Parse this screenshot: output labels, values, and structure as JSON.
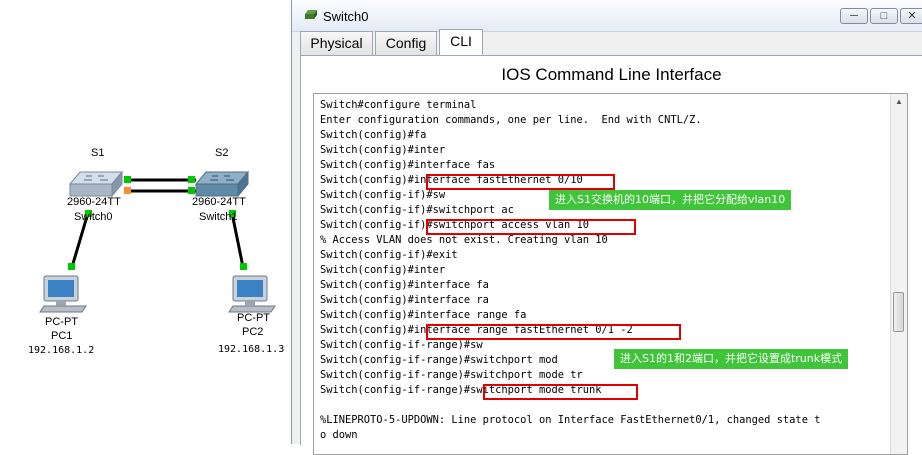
{
  "topology": {
    "switch1": {
      "name": "S1",
      "model": "2960-24TT",
      "hostname": "Switch0"
    },
    "switch2": {
      "name": "S2",
      "model": "2960-24TT",
      "hostname": "Switch1"
    },
    "pc1": {
      "type": "PC-PT",
      "name": "PC1",
      "ip": "192.168.1.2"
    },
    "pc2": {
      "type": "PC-PT",
      "name": "PC2",
      "ip": "192.168.1.3"
    },
    "colors": {
      "link_up": "#00c800",
      "link_blocking": "#ff8c2a"
    }
  },
  "window": {
    "title": "Switch0",
    "minimize_icon": "minimize-icon",
    "maximize_icon": "maximize-icon",
    "close_icon": "close-icon",
    "tabs": [
      {
        "label": "Physical"
      },
      {
        "label": "Config"
      },
      {
        "label": "CLI",
        "active": true
      }
    ],
    "panel_title": "IOS Command Line Interface"
  },
  "terminal": {
    "lines": [
      "Switch#configure terminal",
      "Enter configuration commands, one per line.  End with CNTL/Z.",
      "Switch(config)#fa",
      "Switch(config)#inter",
      "Switch(config)#interface fas",
      "Switch(config)#interface fastEthernet 0/10",
      "Switch(config-if)#sw",
      "Switch(config-if)#switchport ac",
      "Switch(config-if)#switchport access vlan 10",
      "% Access VLAN does not exist. Creating vlan 10",
      "Switch(config-if)#exit",
      "Switch(config)#inter",
      "Switch(config)#interface fa",
      "Switch(config)#interface ra",
      "Switch(config)#interface range fa",
      "Switch(config)#interface range fastEthernet 0/1 -2",
      "Switch(config-if-range)#sw",
      "Switch(config-if-range)#switchport mod",
      "Switch(config-if-range)#switchport mode tr",
      "Switch(config-if-range)#switchport mode trunk",
      "",
      "%LINEPROTO-5-UPDOWN: Line protocol on Interface FastEthernet0/1, changed state t",
      "o down"
    ],
    "annotations": {
      "note1": "进入S1交换机的10端口，并把它分配给vlan10",
      "note2": "进入S1的1和2端口，并把它设置成trunk模式"
    },
    "colors": {
      "highlight_border": "#e00000",
      "note_bg": "#3fc43a"
    }
  }
}
